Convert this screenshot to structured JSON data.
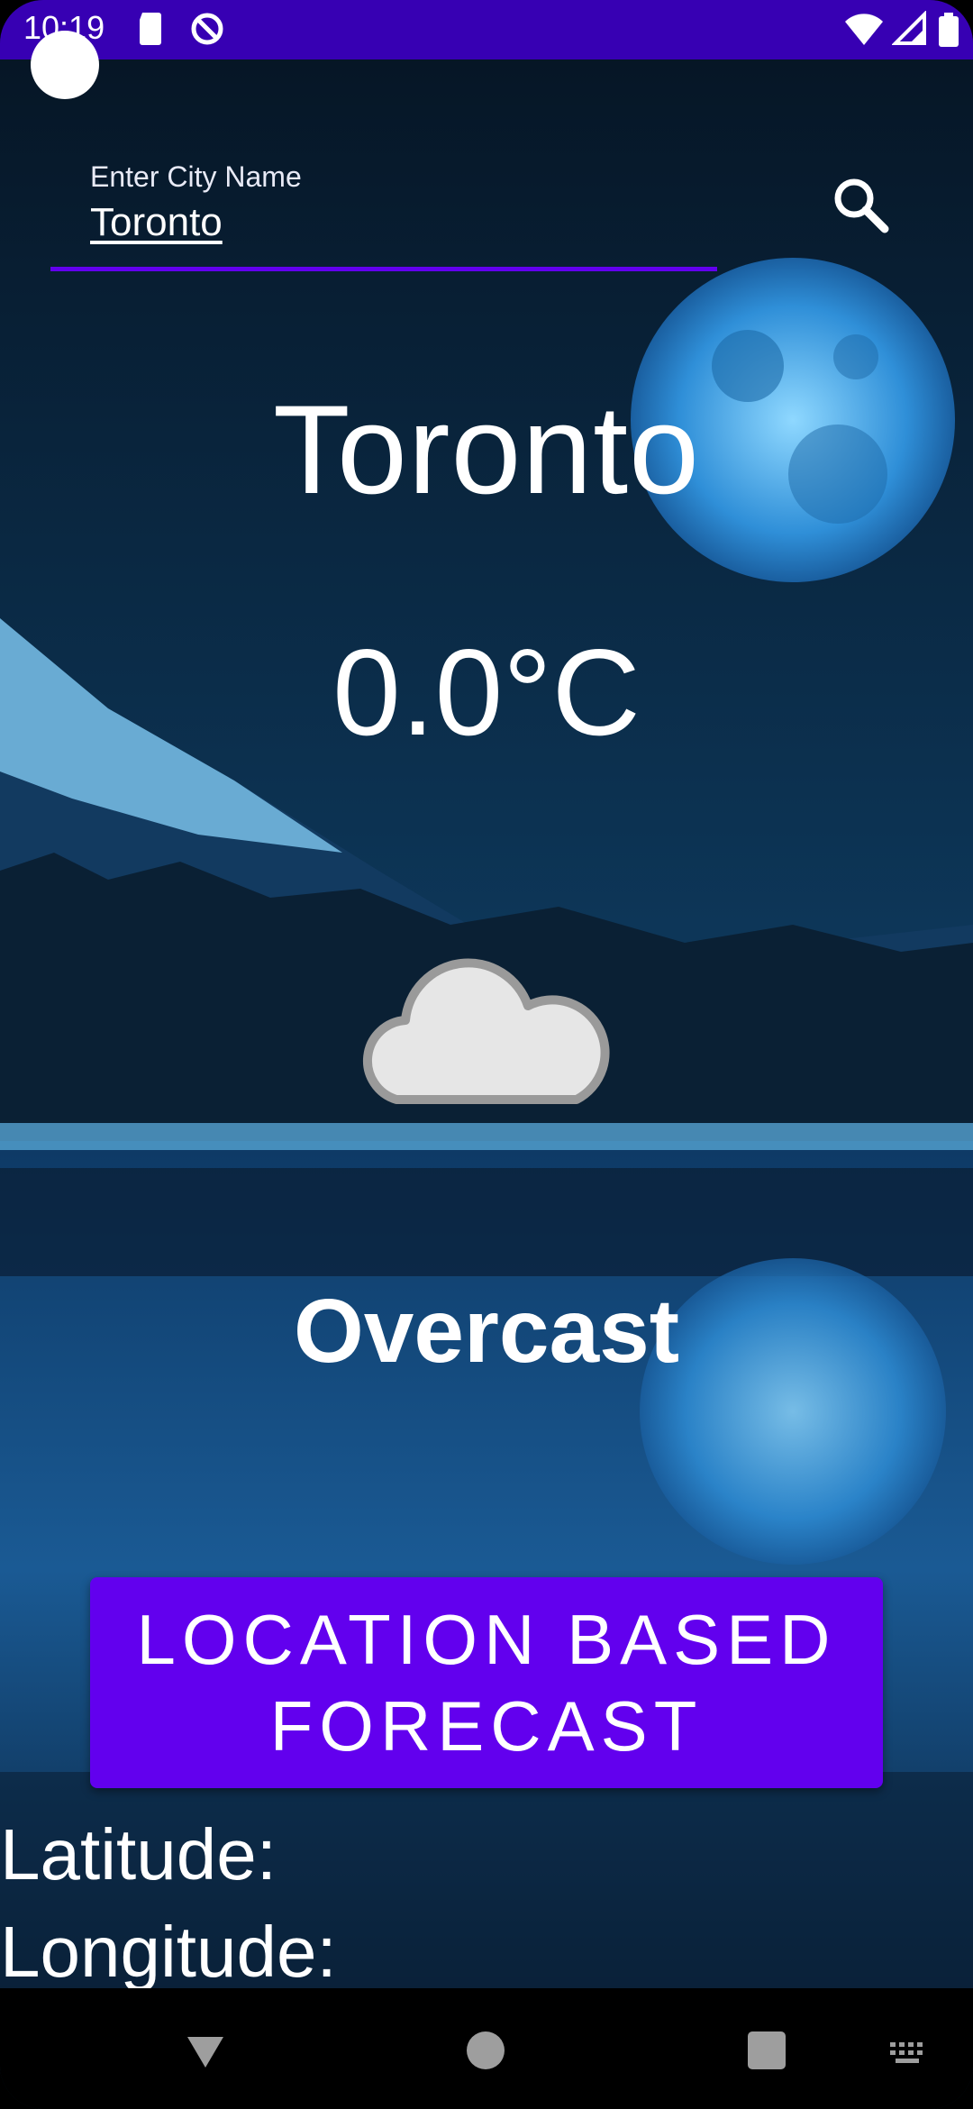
{
  "status_bar": {
    "time": "10:19",
    "icons": [
      "sd-card-icon",
      "do-not-disturb-icon",
      "wifi-icon",
      "signal-icon",
      "battery-icon"
    ]
  },
  "search": {
    "label": "Enter City Name",
    "value": "Toronto",
    "icon": "search-icon"
  },
  "weather": {
    "city": "Toronto",
    "temperature": "0.0°C",
    "condition": "Overcast",
    "condition_icon": "cloud-icon"
  },
  "location_button": {
    "label_line1": "LOCATION BASED",
    "label_line2": "FORECAST"
  },
  "coordinates": {
    "latitude_label": "Latitude:",
    "longitude_label": "Longitude:"
  },
  "navigation": {
    "buttons": [
      "back-icon",
      "home-icon",
      "recents-icon",
      "keyboard-icon"
    ]
  },
  "colors": {
    "accent": "#6200ee",
    "status_bar": "#3700b3"
  }
}
